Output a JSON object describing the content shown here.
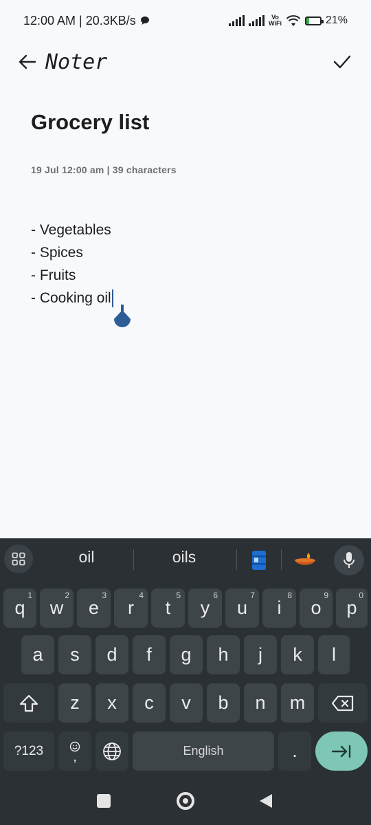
{
  "status_bar": {
    "time_speed": "12:00 AM | 20.3KB/s",
    "vowifi_top": "Vo",
    "vowifi_bottom": "WiFi",
    "battery": "21%"
  },
  "app_bar": {
    "title": "Noter"
  },
  "note": {
    "title": "Grocery list",
    "meta": "19 Jul 12:00 am | 39 characters",
    "lines": [
      "- Vegetables",
      "- Spices",
      "- Fruits",
      "- Cooking oil"
    ]
  },
  "keyboard": {
    "suggestions": [
      "oil",
      "oils"
    ],
    "row1": [
      {
        "key": "q",
        "hint": "1"
      },
      {
        "key": "w",
        "hint": "2"
      },
      {
        "key": "e",
        "hint": "3"
      },
      {
        "key": "r",
        "hint": "4"
      },
      {
        "key": "t",
        "hint": "5"
      },
      {
        "key": "y",
        "hint": "6"
      },
      {
        "key": "u",
        "hint": "7"
      },
      {
        "key": "i",
        "hint": "8"
      },
      {
        "key": "o",
        "hint": "9"
      },
      {
        "key": "p",
        "hint": "0"
      }
    ],
    "row2": [
      "a",
      "s",
      "d",
      "f",
      "g",
      "h",
      "j",
      "k",
      "l"
    ],
    "row3": [
      "z",
      "x",
      "c",
      "v",
      "b",
      "n",
      "m"
    ],
    "symbols_key": "?123",
    "comma_key": ",",
    "space_label": "English",
    "period_key": "."
  },
  "colors": {
    "accent": "#2d5d95",
    "keyboard_bg": "#2a3034",
    "enter_key": "#7ec6b5"
  }
}
